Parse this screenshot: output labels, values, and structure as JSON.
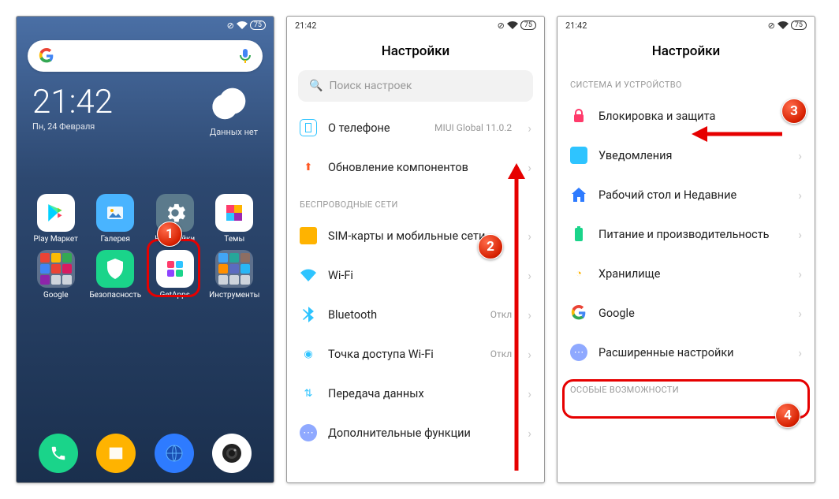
{
  "statusbar": {
    "time": "21:42",
    "battery": "75"
  },
  "home": {
    "clock": "21:42",
    "date": "Пн, 24 Февраля",
    "weather": "Данных нет",
    "apps": [
      {
        "label": "Play Маркет",
        "color": "#fff"
      },
      {
        "label": "Галерея",
        "color": "#49b4ff"
      },
      {
        "label": "Настройки",
        "color": "#597a8e"
      },
      {
        "label": "Темы",
        "color": "#fff"
      },
      {
        "label": "Google",
        "color": "folder"
      },
      {
        "label": "Безопасность",
        "color": "#1ad48a"
      },
      {
        "label": "GetApps",
        "color": "#fff"
      },
      {
        "label": "Инструменты",
        "color": "folder"
      }
    ]
  },
  "settings": {
    "title": "Настройки",
    "search": "Поиск настроек",
    "about": {
      "label": "О телефоне",
      "detail": "MIUI Global 11.0.2"
    },
    "update": {
      "label": "Обновление компонентов"
    },
    "section_wireless": "БЕСПРОВОДНЫЕ СЕТИ",
    "sim": {
      "label": "SIM-карты и мобильные сети"
    },
    "wifi": {
      "label": "Wi-Fi",
      "detail": ""
    },
    "bt": {
      "label": "Bluetooth",
      "detail": "Откл"
    },
    "hotspot": {
      "label": "Точка доступа Wi-Fi",
      "detail": "Откл"
    },
    "data": {
      "label": "Передача данных"
    },
    "addl": {
      "label": "Дополнительные функции"
    }
  },
  "settings2": {
    "title": "Настройки",
    "section_system": "СИСТЕМА И УСТРОЙСТВО",
    "lock": {
      "label": "Блокировка и защита"
    },
    "notif": {
      "label": "Уведомления"
    },
    "desktop": {
      "label": "Рабочий стол и Недавние"
    },
    "power": {
      "label": "Питание и производительность"
    },
    "storage": {
      "label": "Хранилище"
    },
    "google": {
      "label": "Google"
    },
    "advanced": {
      "label": "Расширенные настройки"
    },
    "section_special": "ОСОБЫЕ ВОЗМОЖНОСТИ"
  },
  "badges": {
    "b1": "1",
    "b2": "2",
    "b3": "3",
    "b4": "4"
  }
}
